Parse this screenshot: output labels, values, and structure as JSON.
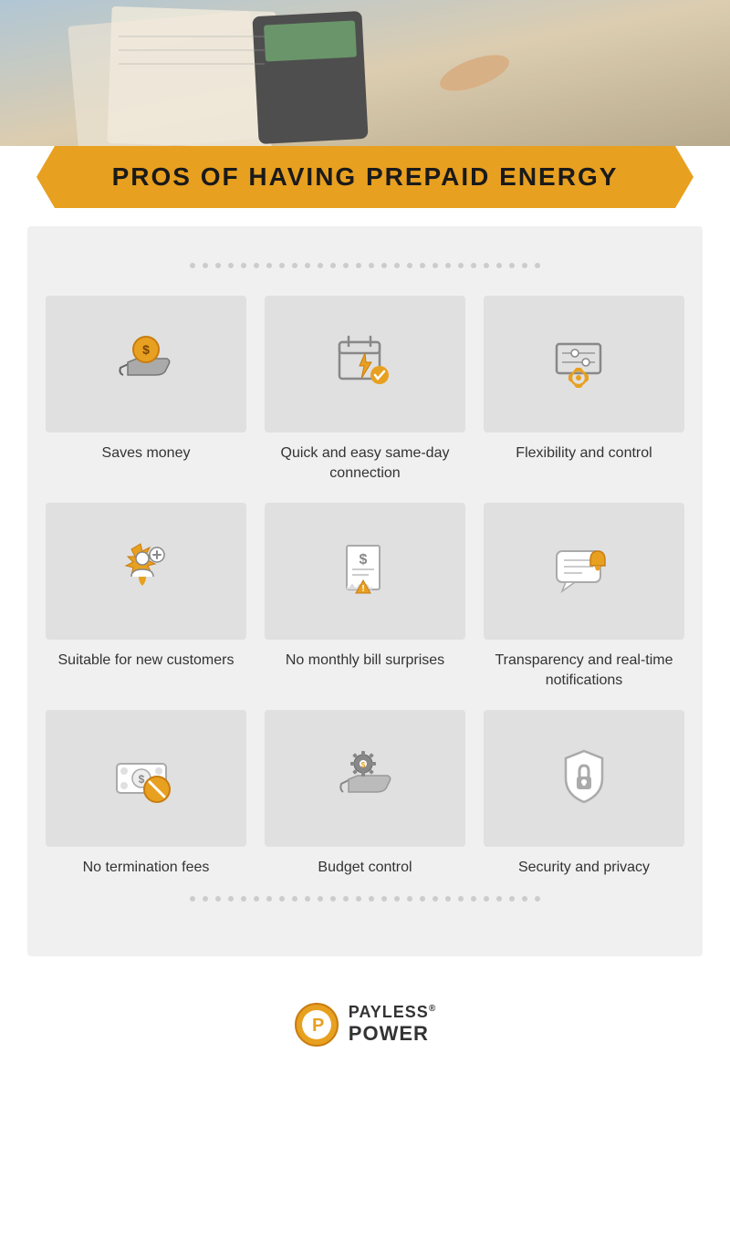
{
  "hero": {
    "alt": "Calculator and financial documents background"
  },
  "title": {
    "main": "PROS OF HAVING PREPAID ENERGY"
  },
  "cards": [
    {
      "id": "saves-money",
      "label": "Saves money",
      "icon": "money-hand-icon"
    },
    {
      "id": "quick-connection",
      "label": "Quick and easy same-day connection",
      "icon": "calendar-bolt-icon"
    },
    {
      "id": "flexibility",
      "label": "Flexibility and control",
      "icon": "sliders-gear-icon"
    },
    {
      "id": "new-customers",
      "label": "Suitable for new customers",
      "icon": "person-star-icon"
    },
    {
      "id": "no-bill-surprises",
      "label": "No monthly bill surprises",
      "icon": "bill-warning-icon"
    },
    {
      "id": "transparency",
      "label": "Transparency and real-time notifications",
      "icon": "chat-bell-icon"
    },
    {
      "id": "no-termination",
      "label": "No termination fees",
      "icon": "money-no-icon"
    },
    {
      "id": "budget-control",
      "label": "Budget control",
      "icon": "gear-hand-icon"
    },
    {
      "id": "security",
      "label": "Security and privacy",
      "icon": "shield-lock-icon"
    }
  ],
  "logo": {
    "company": "PAYLESS",
    "product": "POWER",
    "registered": "®"
  }
}
